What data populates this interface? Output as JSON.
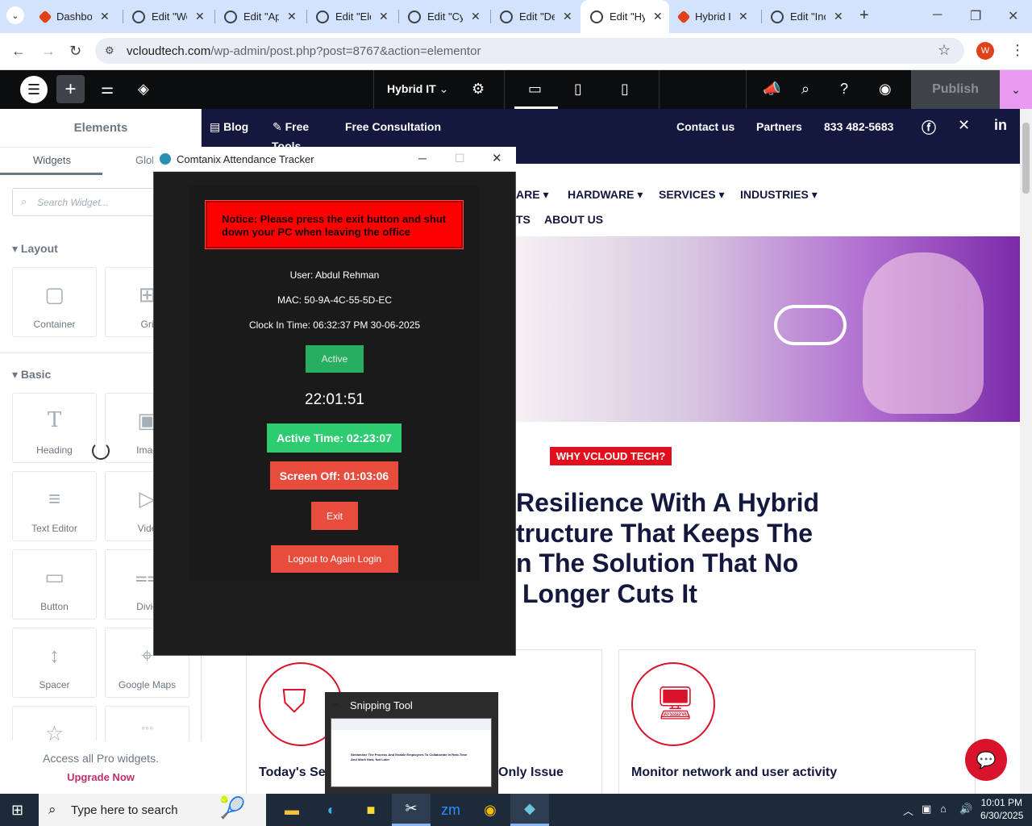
{
  "browser": {
    "tabs": [
      {
        "title": "Dashboard",
        "type": "dash",
        "active": false
      },
      {
        "title": "Edit \"Web",
        "type": "wp",
        "active": false
      },
      {
        "title": "Edit \"App",
        "type": "wp",
        "active": false
      },
      {
        "title": "Edit \"Ele",
        "type": "wp",
        "active": false
      },
      {
        "title": "Edit \"Cy",
        "type": "wp",
        "active": false
      },
      {
        "title": "Edit \"De",
        "type": "wp",
        "active": false
      },
      {
        "title": "Edit \"Hy",
        "type": "wp",
        "active": true
      },
      {
        "title": "Hybrid I",
        "type": "dash",
        "active": false
      },
      {
        "title": "Edit \"Inc",
        "type": "wp",
        "active": false
      }
    ],
    "new_tab": "+",
    "url_host": "vcloudtech.com",
    "url_path": "/wp-admin/post.php?post=8767&action=elementor",
    "profile_initial": "W"
  },
  "elementor": {
    "page_name": "Hybrid IT",
    "publish_label": "Publish",
    "panel": {
      "title": "Elements",
      "tabs": [
        "Widgets",
        "Glob"
      ],
      "search_placeholder": "Search Widget...",
      "layout_section": "Layout",
      "basic_section": "Basic",
      "layout_widgets": [
        "Container",
        "Gri"
      ],
      "basic_widgets": [
        "Heading",
        "Imag",
        "Text Editor",
        "Vide",
        "Button",
        "Divid",
        "Spacer",
        "Google Maps"
      ],
      "pro_text": "Access all Pro widgets.",
      "pro_link": "Upgrade Now"
    }
  },
  "site": {
    "topbar": {
      "blog": "Blog",
      "free_tools": "Free",
      "free_tools_2": "Tools",
      "consultation": "Free Consultation",
      "contact": "Contact us",
      "partners": "Partners",
      "phone": "833 482-5683"
    },
    "menu": [
      "ARE",
      "HARDWARE",
      "SERVICES",
      "INDUSTRIES",
      "TS",
      "ABOUT US"
    ],
    "badge": "WHY VCLOUD TECH?",
    "headline": [
      "Resilience With A Hybrid",
      "tructure That Keeps The",
      "n The Solution That No",
      "Longer Cuts It"
    ],
    "card1_title": "Today's Se",
    "card1_suffix": "Only Issue",
    "card2_title": "Monitor network and user activity"
  },
  "tracker": {
    "window_title": "Comtanix Attendance Tracker",
    "notice": "Notice: Please press the exit button and shut down your PC when leaving the office",
    "user": "User: Abdul Rehman",
    "mac": "MAC: 50-9A-4C-55-5D-EC",
    "clock_in": "Clock In Time: 06:32:37 PM 30-06-2025",
    "status": "Active",
    "clock": "22:01:51",
    "active_time": "Active Time: 02:23:07",
    "screen_off": "Screen Off: 01:03:06",
    "exit": "Exit",
    "logout": "Logout to Again Login"
  },
  "snipping": {
    "title": "Snipping Tool",
    "thumb_text": "Streamline The Process And Enable Employees To Collaborate In Real-Time And Work Now, Not Later"
  },
  "taskbar": {
    "search_placeholder": "Type here to search",
    "time": "10:01 PM",
    "date": "6/30/2025"
  },
  "colors": {
    "site_navy": "#14183e",
    "site_red": "#e0101f",
    "tracker_bg": "#1d1d1d",
    "notice_red": "#ff0000",
    "active_green": "#2ecc71",
    "alert_red": "#e74c3c"
  }
}
